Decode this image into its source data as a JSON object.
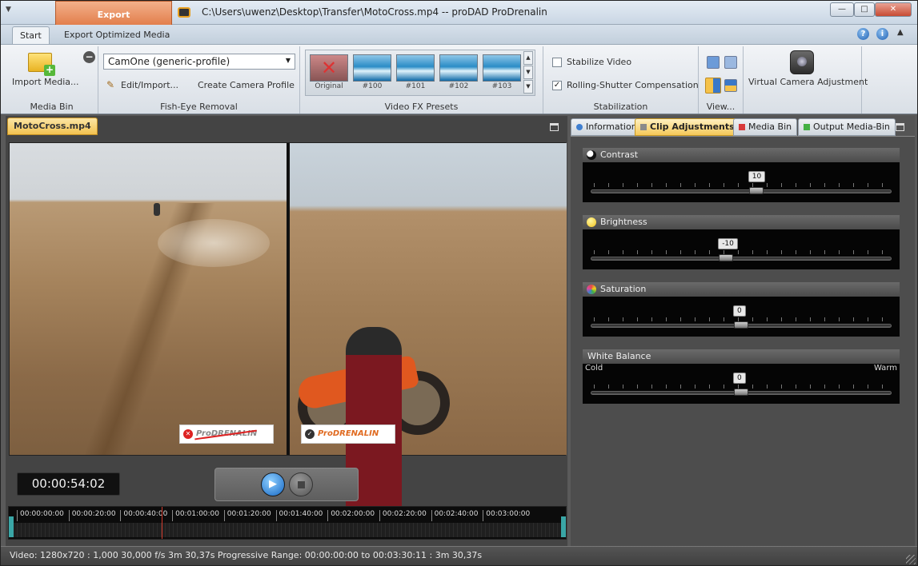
{
  "window": {
    "title": "C:\\Users\\uwenz\\Desktop\\Transfer\\MotoCross.mp4 -- proDAD ProDrenalin",
    "context_tab": "Export",
    "controls": {
      "minimize": "—",
      "maximize": "□",
      "close": "✕"
    }
  },
  "ribbon_tabs": [
    {
      "label": "Start",
      "active": true
    },
    {
      "label": "Export Optimized Media",
      "active": false
    }
  ],
  "ribbon": {
    "media_bin": {
      "import_label": "Import Media...",
      "group_label": "Media Bin"
    },
    "fisheye": {
      "profile": "CamOne (generic-profile)",
      "edit_label": "Edit/Import...",
      "create_label": "Create Camera Profile",
      "group_label": "Fish-Eye Removal"
    },
    "presets": {
      "items": [
        "Original",
        "#100",
        "#101",
        "#102",
        "#103"
      ],
      "group_label": "Video FX Presets"
    },
    "stabilization": {
      "stabilize_label": "Stabilize Video",
      "stabilize_checked": false,
      "rolling_label": "Rolling-Shutter Compensation",
      "rolling_checked": true,
      "group_label": "Stabilization"
    },
    "view": {
      "group_label": "View..."
    },
    "virtual_camera": {
      "label": "Virtual Camera Adjustment"
    }
  },
  "left_pane": {
    "file_tab": "MotoCross.mp4",
    "timecode": "00:00:54:02",
    "timeline_ticks": [
      "00:00:00:00",
      "00:00:20:00",
      "00:00:40:00",
      "00:01:00:00",
      "00:01:20:00",
      "00:01:40:00",
      "00:02:00:00",
      "00:02:20:00",
      "00:02:40:00",
      "00:03:00:00"
    ],
    "playhead_fraction": 0.27,
    "logo_left": "ProDRENALIN",
    "logo_right": "ProDRENALIN"
  },
  "right_pane": {
    "tabs": [
      {
        "label": "Information",
        "color": "#3f7fd0",
        "active": false
      },
      {
        "label": "Clip Adjustments",
        "color": "#a0a0a0",
        "active": true
      },
      {
        "label": "Media Bin",
        "color": "#d83a3a",
        "active": false
      },
      {
        "label": "Output Media-Bin",
        "color": "#43b043",
        "active": false
      }
    ],
    "sliders": [
      {
        "label": "Contrast",
        "value": "10",
        "fraction": 0.55,
        "icon_color": "#222"
      },
      {
        "label": "Brightness",
        "value": "-10",
        "fraction": 0.45,
        "icon_color": "#f2d21b"
      },
      {
        "label": "Saturation",
        "value": "0",
        "fraction": 0.5,
        "icon_color": "#e04a9a"
      },
      {
        "label": "White Balance",
        "value": "0",
        "fraction": 0.5,
        "icon_color": "",
        "left_text": "Cold",
        "right_text": "Warm"
      }
    ]
  },
  "status_bar": "Video: 1280x720 : 1,000   30,000 f/s   3m 30,37s   Progressive   Range: 00:00:00:00 to 00:03:30:11 : 3m 30,37s"
}
